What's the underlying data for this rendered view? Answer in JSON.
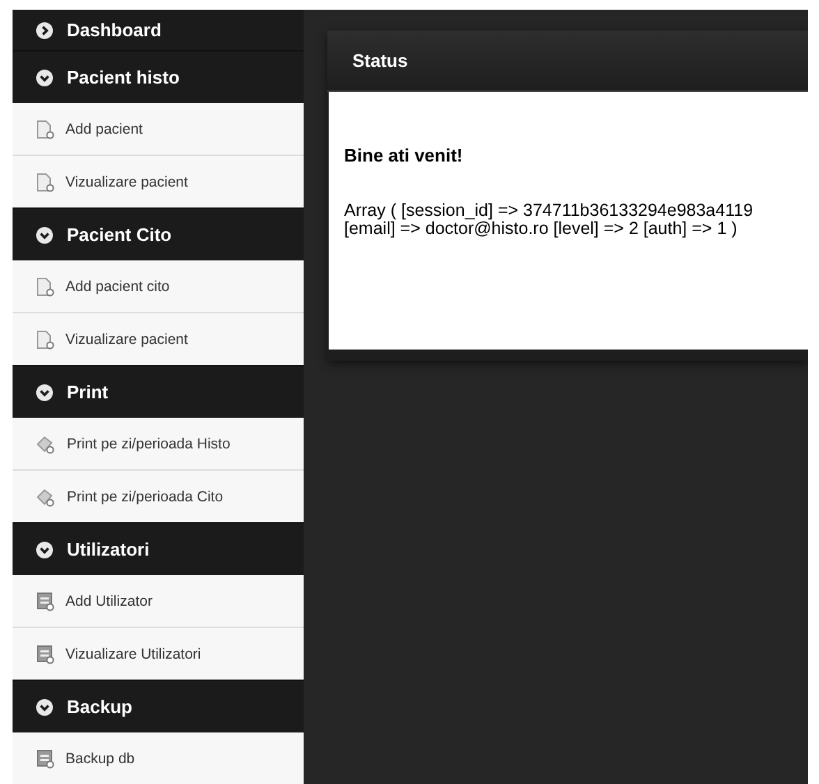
{
  "sidebar": {
    "sections": [
      {
        "label": "Dashboard",
        "expanded": false
      },
      {
        "label": "Pacient histo",
        "expanded": true,
        "items": [
          {
            "label": "Add pacient",
            "kind": "document"
          },
          {
            "label": "Vizualizare pacient",
            "kind": "document"
          }
        ]
      },
      {
        "label": "Pacient Cito",
        "expanded": true,
        "items": [
          {
            "label": "Add pacient cito",
            "kind": "document"
          },
          {
            "label": "Vizualizare pacient",
            "kind": "document"
          }
        ]
      },
      {
        "label": "Print",
        "expanded": true,
        "items": [
          {
            "label": "Print pe zi/perioada Histo",
            "kind": "print"
          },
          {
            "label": "Print pe zi/perioada Cito",
            "kind": "print"
          }
        ]
      },
      {
        "label": "Utilizatori",
        "expanded": true,
        "items": [
          {
            "label": "Add Utilizator",
            "kind": "form"
          },
          {
            "label": "Vizualizare Utilizatori",
            "kind": "form"
          }
        ]
      },
      {
        "label": "Backup",
        "expanded": true,
        "items": [
          {
            "label": "Backup db",
            "kind": "form"
          }
        ]
      }
    ]
  },
  "status_panel": {
    "title": "Status",
    "heading": "Bine ati venit!",
    "lines": [
      "Array ( [session_id] => 374711b36133294e983a4119",
      "[email] => doctor@histo.ro [level] => 2 [auth] => 1 )"
    ]
  }
}
